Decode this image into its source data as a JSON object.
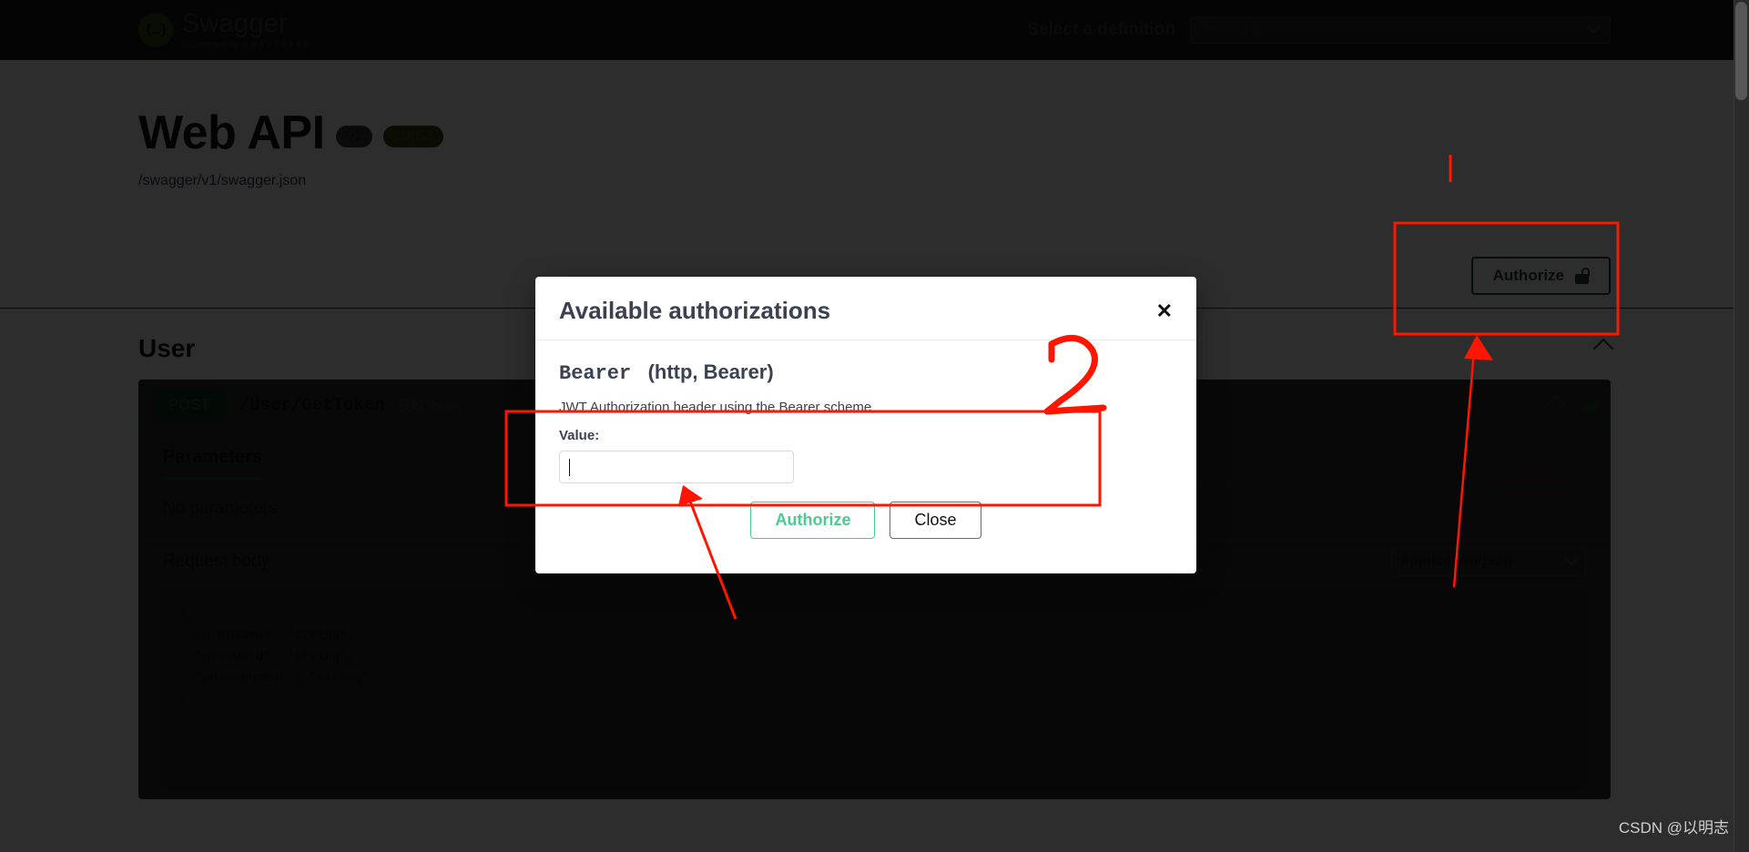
{
  "topbar": {
    "logo_title": "Swagger",
    "logo_sub_prefix": "Supported by ",
    "logo_sub_brand": "SMARTBEAR",
    "logo_glyph": "{…}",
    "definition_label": "Select a definition",
    "definition_value": "My API V1"
  },
  "info": {
    "title": "Web API",
    "version_badge": "v1",
    "oas_badge": "OAS3",
    "spec_link": "/swagger/v1/swagger.json"
  },
  "auth": {
    "authorize_label": "Authorize"
  },
  "section": {
    "title": "User"
  },
  "operation": {
    "method": "POST",
    "path": "/User/GetToken",
    "summary": "获取Token",
    "params_tab": "Parameters",
    "cancel_label": "Cancel",
    "no_parameters": "No parameters",
    "request_body_label": "Request body",
    "content_type": "application/json",
    "body_example": "{\n  \"userName\": \"string\",\n  \"password\": \"string\",\n  \"phoneNumber\": \"string\"\n}"
  },
  "modal": {
    "title": "Available authorizations",
    "close_glyph": "✕",
    "scheme_name": "Bearer",
    "scheme_type": "(http, Bearer)",
    "scheme_description": "JWT Authorization header using the Bearer scheme",
    "value_label": "Value:",
    "value_input": "",
    "value_placeholder": "",
    "authorize_label": "Authorize",
    "close_label": "Close"
  },
  "annotations": {
    "step_number": "2"
  },
  "watermark": "CSDN @以明志",
  "colors": {
    "accent_green": "#49cc90",
    "annotation_red": "#ff1500",
    "header_dark": "#1b1b1b"
  }
}
